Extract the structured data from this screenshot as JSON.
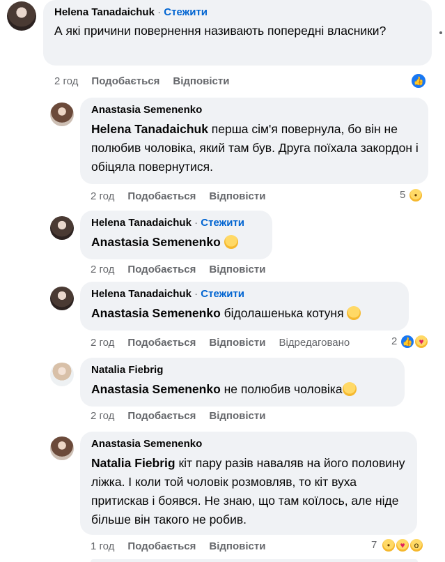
{
  "comments": [
    {
      "author": "Helena Tanadaichuk",
      "follow": "Стежити",
      "text": "А які причини повернення називають попередні власники?",
      "time": "2 год",
      "like": "Подобається",
      "reply": "Відповісти"
    },
    {
      "author": "Anastasia Semenenko",
      "mention": "Helena Tanadaichuk",
      "text": " перша сім'я повернула, бо він не полюбив чоловіка, який там був. Друга поїхала закордон і обіцяла повернутися.",
      "time": "2 год",
      "like": "Подобається",
      "reply": "Відповісти",
      "reaction_count": "5"
    },
    {
      "author": "Helena Tanadaichuk",
      "follow": "Стежити",
      "mention": "Anastasia Semenenko",
      "time": "2 год",
      "like": "Подобається",
      "reply": "Відповісти"
    },
    {
      "author": "Helena Tanadaichuk",
      "follow": "Стежити",
      "mention": "Anastasia Semenenko",
      "text": " бідолашенька котуня",
      "time": "2 год",
      "like": "Подобається",
      "reply": "Відповісти",
      "edited": "Відредаговано",
      "reaction_count": "2"
    },
    {
      "author": "Natalia Fiebrig",
      "mention": "Anastasia Semenenko",
      "text": " не полюбив чоловіка",
      "time": "2 год",
      "like": "Подобається",
      "reply": "Відповісти"
    },
    {
      "author": "Anastasia Semenenko",
      "mention": "Natalia Fiebrig",
      "text": " кіт пару разів наваляв на його половину ліжка. І коли той чоловік розмовляв, то кіт вуха притискав і боявся. Не знаю, що там коїлось, але ніде більше він такого не робив.",
      "time": "1 год",
      "like": "Подобається",
      "reply": "Відповісти",
      "reaction_count": "7"
    }
  ],
  "separator": "·",
  "icons": {
    "like": "like-reaction-icon",
    "sad": "sad-reaction-icon",
    "care": "care-reaction-icon",
    "wow": "wow-reaction-icon"
  },
  "colors": {
    "bubble": "#f0f2f5",
    "link": "#0064d1",
    "meta": "#65676b",
    "like_blue": "#1877f2"
  }
}
